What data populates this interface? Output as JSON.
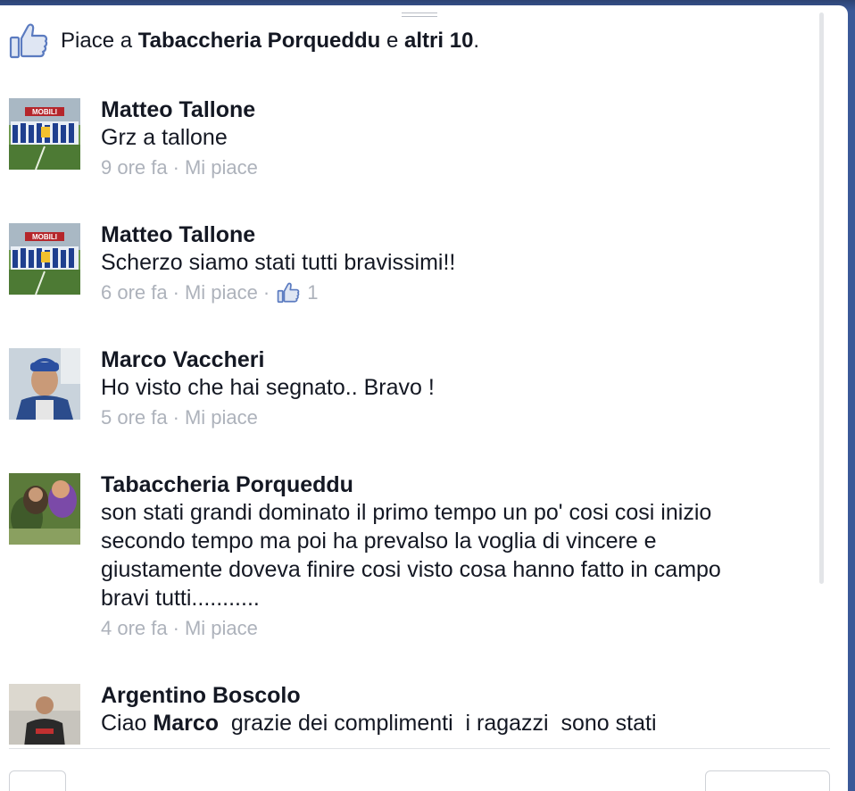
{
  "likes": {
    "prefix": "Piace a ",
    "first_liker": "Tabaccheria Porqueddu",
    "middle": " e ",
    "others": "altri 10",
    "suffix": "."
  },
  "comments": [
    {
      "author": "Matteo Tallone",
      "text": "Grz a tallone",
      "time": "9 ore fa",
      "like_label": "Mi piace",
      "like_count": ""
    },
    {
      "author": "Matteo Tallone",
      "text": "Scherzo siamo stati tutti bravissimi!!",
      "time": "6 ore fa",
      "like_label": "Mi piace",
      "like_count": "1"
    },
    {
      "author": "Marco Vaccheri",
      "text": "Ho visto che hai segnato.. Bravo !",
      "time": "5 ore fa",
      "like_label": "Mi piace",
      "like_count": ""
    },
    {
      "author": "Tabaccheria Porqueddu",
      "text_lines": [
        "son stati grandi dominato il primo tempo un po' cosi cosi inizio",
        "secondo tempo ma poi ha prevalso la voglia di vincere e",
        "giustamente doveva finire cosi visto cosa hanno fatto in campo",
        "bravi tutti..........."
      ],
      "time": "4 ore fa",
      "like_label": "Mi piace",
      "like_count": ""
    },
    {
      "author": "Argentino Boscolo",
      "text_prefix": "Ciao ",
      "text_mention": "Marco",
      "text_rest": "  grazie dei complimenti  i ragazzi  sono stati"
    }
  ],
  "avatar_banner_text": "MOBILI",
  "colors": {
    "brand": "#3b5998",
    "text": "#141823",
    "meta": "#adb2bb",
    "thumb": "#5b7bc0"
  },
  "icons": {
    "likes_icon": "thumbs-up-icon",
    "comment_like_icon": "thumbs-up-icon"
  }
}
